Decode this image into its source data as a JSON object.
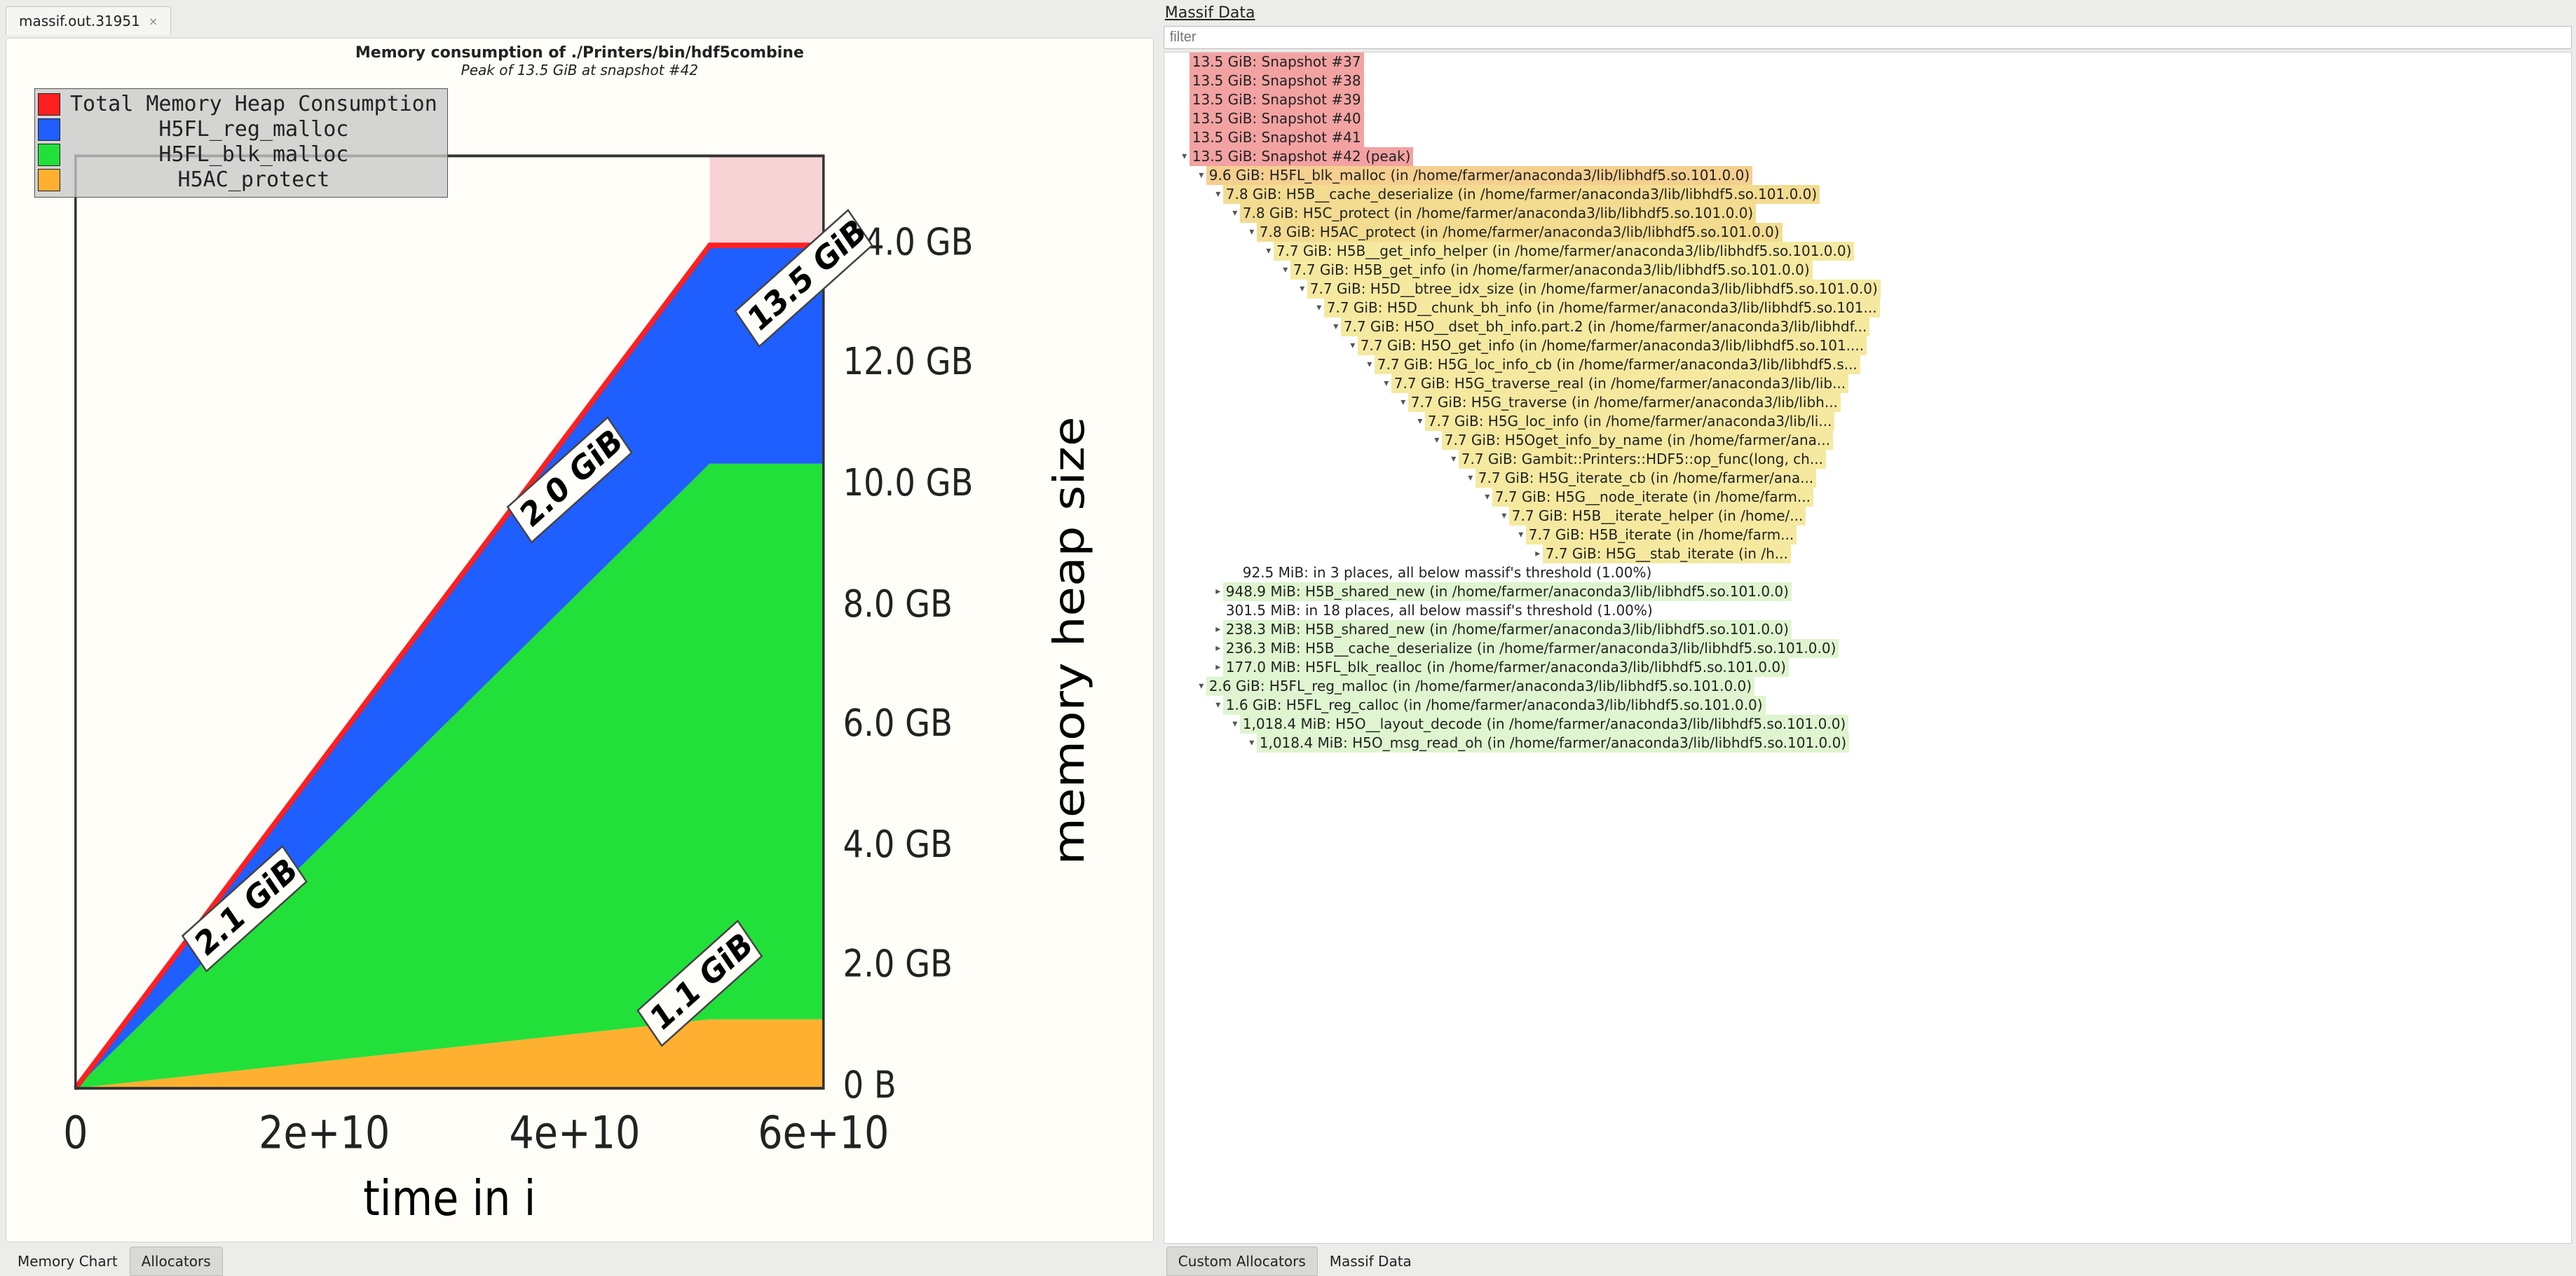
{
  "file_tab": {
    "label": "massif.out.31951"
  },
  "chart": {
    "title": "Memory consumption of ./Printers/bin/hdf5combine",
    "subtitle": "Peak of 13.5 GiB at snapshot #42",
    "xlabel": "time in i",
    "ylabel": "memory heap size",
    "legend": [
      {
        "label": "Total Memory Heap Consumption",
        "color": "#ff1f1f"
      },
      {
        "label": "H5FL_reg_malloc",
        "color": "#1f5eff"
      },
      {
        "label": "H5FL_blk_malloc",
        "color": "#22e03a"
      },
      {
        "label": "H5AC_protect",
        "color": "#ffB030"
      }
    ],
    "xticks": [
      "0",
      "2e+10",
      "4e+10",
      "6e+10"
    ],
    "yticks": [
      "0 B",
      "2.0 GB",
      "4.0 GB",
      "6.0 GB",
      "8.0 GB",
      "10.0 GB",
      "12.0 GB",
      "14.0 GB"
    ],
    "annotations": {
      "lower_left": "2.1 GiB",
      "upper_center": "2.0 GiB",
      "upper_right": "13.5 GiB",
      "lower_right": "1.1 GiB"
    }
  },
  "chart_data": {
    "type": "area",
    "xlabel": "time in i",
    "ylabel": "memory heap size",
    "xlim": [
      0,
      63000000000.0
    ],
    "ylim_gb": [
      0,
      15.5
    ],
    "peak_snapshot": 42,
    "peak_size_gib": 13.5,
    "x": [
      0,
      20000000000.0,
      40000000000.0,
      50000000000.0,
      63000000000.0
    ],
    "series": [
      {
        "name": "Total Memory Heap Consumption",
        "color": "#ff1f1f",
        "values_gb": [
          0,
          5.4,
          10.8,
          13.5,
          13.5
        ]
      },
      {
        "name": "H5FL_reg_malloc",
        "color": "#1f5eff",
        "peak_gib": 2.1,
        "stack_top_gb": [
          0,
          5.4,
          10.8,
          13.5,
          13.5
        ]
      },
      {
        "name": "H5FL_blk_malloc",
        "color": "#22e03a",
        "peak_gib": 2.0,
        "stack_top_gb": [
          0,
          4.0,
          8.0,
          10.0,
          10.0
        ]
      },
      {
        "name": "H5AC_protect",
        "color": "#ffB030",
        "peak_gib": 1.1,
        "stack_top_gb": [
          0,
          0.44,
          0.88,
          1.1,
          1.1
        ]
      }
    ],
    "peak_band_x": [
      50000000000.0,
      63000000000.0
    ]
  },
  "left_tabs": {
    "memory_chart": "Memory Chart",
    "allocators": "Allocators",
    "selected": "allocators"
  },
  "right": {
    "header": "Massif Data",
    "filter_placeholder": "filter",
    "bottom_tabs": {
      "custom": "Custom Allocators",
      "massif": "Massif Data",
      "selected": "custom"
    }
  },
  "lib_suffix": " (in /home/farmer/anaconda3/lib/libhdf5.so.101.0.0)",
  "tree": [
    {
      "d": 0,
      "heat": "red",
      "arr": "",
      "txt": "13.5 GiB: Snapshot #37"
    },
    {
      "d": 0,
      "heat": "red",
      "arr": "",
      "txt": "13.5 GiB: Snapshot #38"
    },
    {
      "d": 0,
      "heat": "red",
      "arr": "",
      "txt": "13.5 GiB: Snapshot #39"
    },
    {
      "d": 0,
      "heat": "red",
      "arr": "",
      "txt": "13.5 GiB: Snapshot #40"
    },
    {
      "d": 0,
      "heat": "red",
      "arr": "",
      "txt": "13.5 GiB: Snapshot #41"
    },
    {
      "d": 0,
      "heat": "red",
      "arr": "v",
      "txt": "13.5 GiB: Snapshot #42 (peak)"
    },
    {
      "d": 1,
      "heat": "orange",
      "arr": "v",
      "txt": "9.6 GiB: H5FL_blk_malloc",
      "lib": true
    },
    {
      "d": 2,
      "heat": "gold",
      "arr": "v",
      "txt": "7.8 GiB: H5B__cache_deserialize",
      "lib": true
    },
    {
      "d": 3,
      "heat": "gold",
      "arr": "v",
      "txt": "7.8 GiB: H5C_protect",
      "lib": true
    },
    {
      "d": 4,
      "heat": "gold",
      "arr": "v",
      "txt": "7.8 GiB: H5AC_protect",
      "lib": true
    },
    {
      "d": 5,
      "heat": "yellow",
      "arr": "v",
      "txt": "7.7 GiB: H5B__get_info_helper",
      "lib": true
    },
    {
      "d": 6,
      "heat": "yellow",
      "arr": "v",
      "txt": "7.7 GiB: H5B_get_info",
      "lib": true
    },
    {
      "d": 7,
      "heat": "yellow",
      "arr": "v",
      "txt": "7.7 GiB: H5D__btree_idx_size",
      "lib": true
    },
    {
      "d": 8,
      "heat": "yellow",
      "arr": "v",
      "txt": "7.7 GiB: H5D__chunk_bh_info (in /home/farmer/anaconda3/lib/libhdf5.so.101..."
    },
    {
      "d": 9,
      "heat": "yellow",
      "arr": "v",
      "txt": "7.7 GiB: H5O__dset_bh_info.part.2 (in /home/farmer/anaconda3/lib/libhdf..."
    },
    {
      "d": 10,
      "heat": "yellow",
      "arr": "v",
      "txt": "7.7 GiB: H5O_get_info (in /home/farmer/anaconda3/lib/libhdf5.so.101...."
    },
    {
      "d": 11,
      "heat": "yellow",
      "arr": "v",
      "txt": "7.7 GiB: H5G_loc_info_cb (in /home/farmer/anaconda3/lib/libhdf5.s..."
    },
    {
      "d": 12,
      "heat": "yellow",
      "arr": "v",
      "txt": "7.7 GiB: H5G_traverse_real (in /home/farmer/anaconda3/lib/lib..."
    },
    {
      "d": 13,
      "heat": "yellow",
      "arr": "v",
      "txt": "7.7 GiB: H5G_traverse (in /home/farmer/anaconda3/lib/libh..."
    },
    {
      "d": 14,
      "heat": "yellow",
      "arr": "v",
      "txt": "7.7 GiB: H5G_loc_info (in /home/farmer/anaconda3/lib/li..."
    },
    {
      "d": 15,
      "heat": "yellow",
      "arr": "v",
      "txt": "7.7 GiB: H5Oget_info_by_name (in /home/farmer/ana..."
    },
    {
      "d": 16,
      "heat": "yellow",
      "arr": "v",
      "txt": "7.7 GiB: Gambit::Printers::HDF5::op_func(long, ch..."
    },
    {
      "d": 17,
      "heat": "yellow",
      "arr": "v",
      "txt": "7.7 GiB: H5G_iterate_cb (in /home/farmer/ana..."
    },
    {
      "d": 18,
      "heat": "yellow",
      "arr": "v",
      "txt": "7.7 GiB: H5G__node_iterate (in /home/farm..."
    },
    {
      "d": 19,
      "heat": "yellow",
      "arr": "v",
      "txt": "7.7 GiB: H5B__iterate_helper (in /home/..."
    },
    {
      "d": 20,
      "heat": "yellow",
      "arr": "v",
      "txt": "7.7 GiB: H5B_iterate (in /home/farm..."
    },
    {
      "d": 21,
      "heat": "yellow",
      "arr": ">",
      "txt": "7.7 GiB: H5G__stab_iterate (in /h..."
    },
    {
      "d": 3,
      "heat": "none",
      "arr": "",
      "txt": "92.5 MiB: in 3 places, all below massif's threshold (1.00%)"
    },
    {
      "d": 2,
      "heat": "green",
      "arr": ">",
      "txt": "948.9 MiB: H5B_shared_new",
      "lib": true
    },
    {
      "d": 2,
      "heat": "none",
      "arr": "",
      "txt": "301.5 MiB: in 18 places, all below massif's threshold (1.00%)"
    },
    {
      "d": 2,
      "heat": "green",
      "arr": ">",
      "txt": "238.3 MiB: H5B_shared_new",
      "lib": true
    },
    {
      "d": 2,
      "heat": "green",
      "arr": ">",
      "txt": "236.3 MiB: H5B__cache_deserialize",
      "lib": true
    },
    {
      "d": 2,
      "heat": "green",
      "arr": ">",
      "txt": "177.0 MiB: H5FL_blk_realloc",
      "lib": true
    },
    {
      "d": 1,
      "heat": "green",
      "arr": "v",
      "txt": "2.6 GiB: H5FL_reg_malloc",
      "lib": true
    },
    {
      "d": 2,
      "heat": "green",
      "arr": "v",
      "txt": "1.6 GiB: H5FL_reg_calloc",
      "lib": true
    },
    {
      "d": 3,
      "heat": "green",
      "arr": "v",
      "txt": "1,018.4 MiB: H5O__layout_decode",
      "lib": true
    },
    {
      "d": 4,
      "heat": "green",
      "arr": "v",
      "txt": "1,018.4 MiB: H5O_msg_read_oh",
      "lib": true
    }
  ]
}
